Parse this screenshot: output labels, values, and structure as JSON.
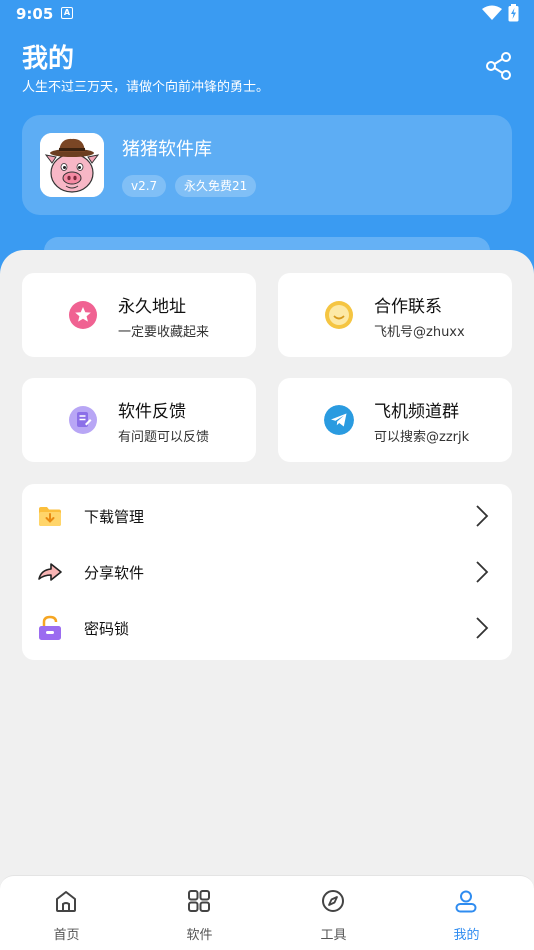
{
  "status_bar": {
    "time": "9:05",
    "notification_letter": "A"
  },
  "header": {
    "title": "我的",
    "subtitle": "人生不过三万天，请做个向前冲锋的勇士。"
  },
  "profile": {
    "app_name": "猪猪软件库",
    "version": "v2.7",
    "tag": "永久免费21"
  },
  "tiles": [
    {
      "title": "永久地址",
      "subtitle": "一定要收藏起来",
      "icon": "star-icon",
      "color": "#f06292"
    },
    {
      "title": "合作联系",
      "subtitle": "飞机号@zhuxx",
      "icon": "smile-icon",
      "color": "#f5c542"
    },
    {
      "title": "软件反馈",
      "subtitle": "有问题可以反馈",
      "icon": "feedback-icon",
      "color": "#9a7ef0"
    },
    {
      "title": "飞机频道群",
      "subtitle": "可以搜索@zzrjk",
      "icon": "telegram-icon",
      "color": "#2a9be0"
    }
  ],
  "menu": [
    {
      "label": "下载管理",
      "icon": "download-folder-icon"
    },
    {
      "label": "分享软件",
      "icon": "share-arrow-icon"
    },
    {
      "label": "密码锁",
      "icon": "lock-icon"
    }
  ],
  "nav": [
    {
      "label": "首页",
      "icon": "home-icon"
    },
    {
      "label": "软件",
      "icon": "grid-icon"
    },
    {
      "label": "工具",
      "icon": "compass-icon"
    },
    {
      "label": "我的",
      "icon": "user-icon",
      "active": true
    }
  ],
  "colors": {
    "primary": "#3a9bf2",
    "nav_active": "#2f8cf0",
    "background": "#f0f0f0"
  }
}
